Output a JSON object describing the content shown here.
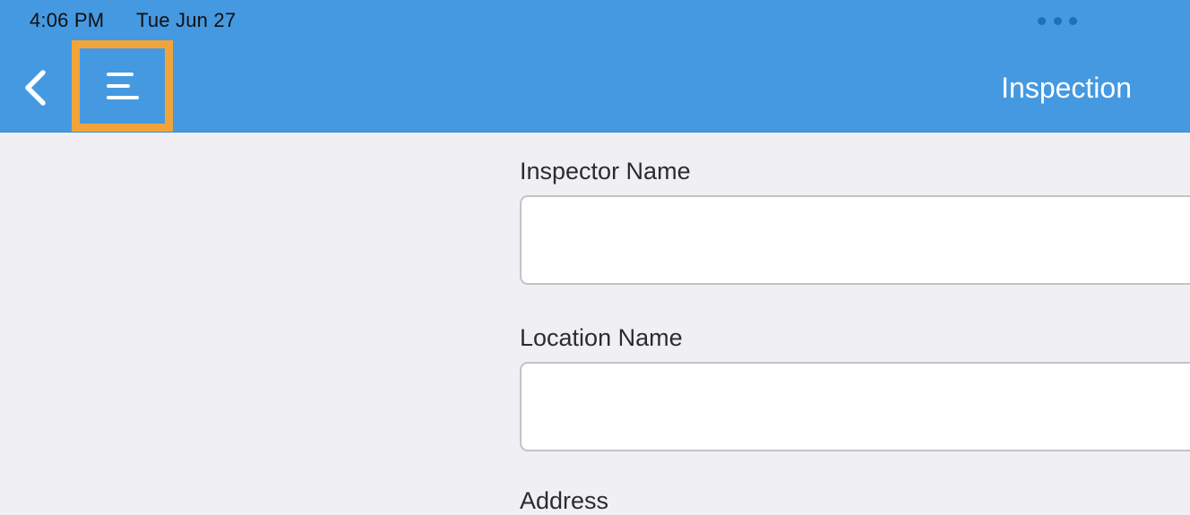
{
  "status_bar": {
    "time": "4:06 PM",
    "date": "Tue Jun 27"
  },
  "nav_bar": {
    "back_icon": "chevron-left-icon",
    "menu_icon": "menu-lines-icon",
    "title": "Inspection",
    "highlight_color": "#f2a43a",
    "background_color": "#4599e1"
  },
  "form": {
    "fields": [
      {
        "label": "Inspector Name",
        "value": "",
        "placeholder": ""
      },
      {
        "label": "Location Name",
        "value": "",
        "placeholder": ""
      },
      {
        "label": "Address",
        "value": "",
        "placeholder": ""
      }
    ]
  }
}
